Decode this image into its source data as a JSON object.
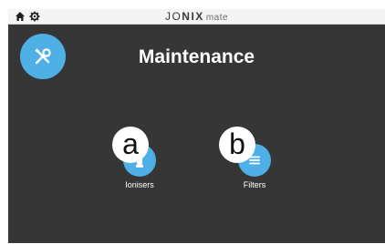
{
  "topbar": {
    "brand_part1": "JO",
    "brand_part2": "NIX",
    "brand_part3": "mate",
    "icons": [
      "home-icon",
      "gear-icon"
    ]
  },
  "main": {
    "title": "Maintenance",
    "tools_icon": "wrench-screwdriver-icon",
    "buttons": [
      {
        "label": "Ionisers",
        "icon": "ioniser-tube-icon",
        "badge": "a"
      },
      {
        "label": "Filters",
        "icon": "filter-lines-icon",
        "badge": "b"
      }
    ]
  },
  "colors": {
    "accent": "#4fb0e5",
    "background": "#363636",
    "topbar": "#f4f4f4",
    "text": "#ffffff"
  }
}
